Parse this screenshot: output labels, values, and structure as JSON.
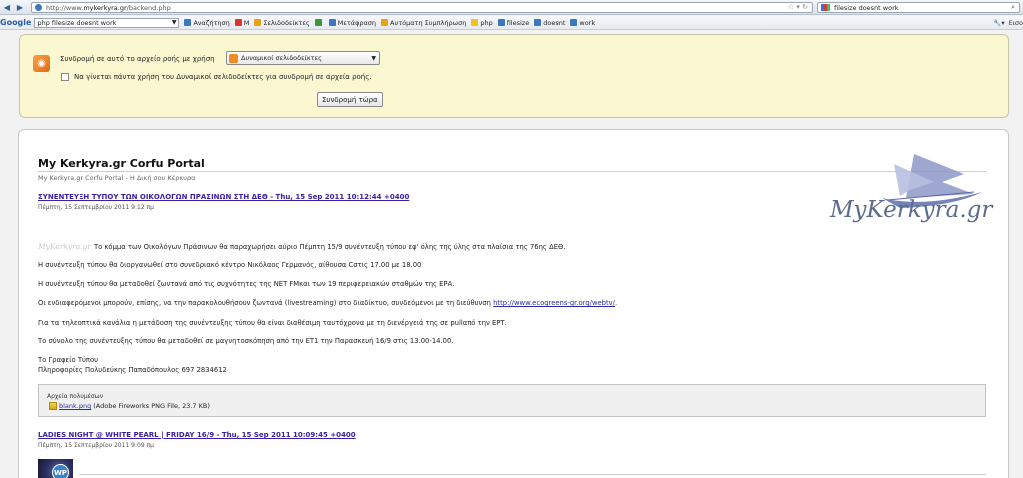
{
  "browser": {
    "url_prefix": "http://www.",
    "url_host": "mykerkyra.gr",
    "url_path": "/backend.php",
    "search_value": "filesize doesnt work"
  },
  "toolbar": {
    "logo": "Google",
    "search_value": "php filesize doesnt work",
    "items": [
      {
        "label": "Αναζήτηση",
        "color": "#3b78c2"
      },
      {
        "label": "M",
        "color": "#d33"
      },
      {
        "label": "Σελιδοδείκτες",
        "color": "#e8a317"
      },
      {
        "label": "",
        "color": "#3a9a3a"
      },
      {
        "label": "Μετάφραση",
        "color": "#3b78c2"
      },
      {
        "label": "Αυτόματη Συμπλήρωση",
        "color": "#e8a317"
      },
      {
        "label": "php",
        "color": "#f0c419"
      },
      {
        "label": "filesize",
        "color": "#3b78c2"
      },
      {
        "label": "doesnt",
        "color": "#3b78c2"
      },
      {
        "label": "work",
        "color": "#3b78c2"
      }
    ],
    "right_label": "Εισο"
  },
  "subscribe": {
    "label": "Συνδρομή σε αυτό το αρχείο ροής με χρήση",
    "selected": "Δυναμικοί σελιδοδείκτες",
    "checkbox_label": "Να γίνεται πάντα χρήση του Δυναμικοί σελιδοδείκτες για συνδρομή σε αρχεία ροής.",
    "button": "Συνδρομή τώρα"
  },
  "feed": {
    "title": "My Kerkyra.gr Corfu Portal",
    "subtitle": "My Kerkyra.gr Corfu Portal - Η Δική σου Κέρκυρα",
    "logo_text": "MyKerkyra.gr",
    "item1": {
      "title": "ΣΥΝΕΝΤΕΥΞΗ ΤΥΠΟΥ ΤΩΝ ΟΙΚΟΛΟΓΩΝ ΠΡΑΣΙΝΩΝ ΣΤΗ ΔΕΘ - Thu, 15 Sep 2011 10:12:44 +0400",
      "date": "Πέμπτη, 15 Σεπτεμβρίου 2011 9:12 πμ",
      "watermark": "MyKerkyra.gr",
      "p1": "Το κόμμα των Οικολόγων Πράσινων θα παραχωρήσει αύριο Πέμπτη 15/9 συνέντευξη τύπου εφ' όλης της ύλης στα πλαίσια της 76ης ΔΕΘ.",
      "p2": "Η συνέντευξη τύπου θα διοργανωθεί στο συνεδριακό κέντρο Νικόλαος Γερμανός, αίθουσα Cστις 17.00 με 18.00",
      "p3": "Η συνέντευξη τύπου θα μεταδοθεί ζωντανά από τις συχνότητες της NET FMκαι των 19 περιφερειακών σταθμών της ΕΡΑ.",
      "p4_pre": "Οι ενδιαφερόμενοι μπορούν, επίσης, να την παρακολουθήσουν ζωντανά (livestreaming) στο διαδίκτυο, συνδεόμενοι με τη διεύθυνση",
      "p4_link": "http://www.ecogreens-gr.org/webtv/",
      "p4_post": ".",
      "p5": "Για τα τηλεοπτικά κανάλια η μετάδοση της συνέντευξης τύπου θα είναι διαθέσιμη ταυτόχρονα με τη διενέργειά της σε pullαπό την ΕΡΤ.",
      "p6": "Το σύνολο της συνέντευξης τύπου θα μεταδοθεί σε μαγνητοσκόπηση από την ΕΤ1 την Παρασκευή 16/9 στις 13.00-14.00.",
      "sign1": "Το Γραφείο Τύπου",
      "sign2": "Πληροφορίες Πολυδεύκης Παπαδόπουλος 697 2834612",
      "attach_head": "Αρχεία πολυμέσων",
      "attach_file": "blank.png",
      "attach_meta": "(Adobe Fireworks PNG File, 23.7 KB)"
    },
    "item2": {
      "title": "LADIES NIGHT @ WHITE PEARL | FRIDAY 16/9 - Thu, 15 Sep 2011 10:09:45 +0400",
      "date": "Πέμπτη, 15 Σεπτεμβρίου 2011 9:09 πμ",
      "thumb_text": "WP"
    }
  }
}
